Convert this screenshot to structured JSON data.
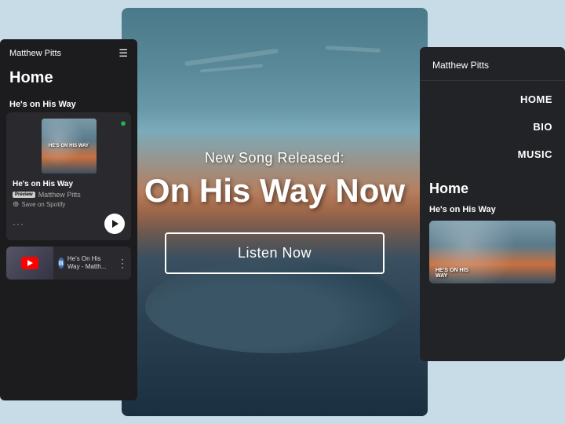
{
  "left_panel": {
    "header_title": "Matthew Pitts",
    "home_label": "Home",
    "section_title": "He's on His Way",
    "song_title": "He's on His Way",
    "artist": "Matthew Pitts",
    "preview_badge": "Preview",
    "save_label": "Save on Spotify",
    "yt_title": "He's On His Way - Matth...",
    "yt_channel": "B"
  },
  "center_panel": {
    "subtitle": "New Song Released:",
    "title": "On His Way Now",
    "listen_btn": "Listen Now"
  },
  "right_panel": {
    "header_title": "Matthew Pitts",
    "nav_items": [
      "HOME",
      "BIO",
      "MUSIC"
    ],
    "home_label": "Home",
    "card_title": "He's on His Way",
    "album_text": "HE'S ON HIS\nWAY"
  }
}
